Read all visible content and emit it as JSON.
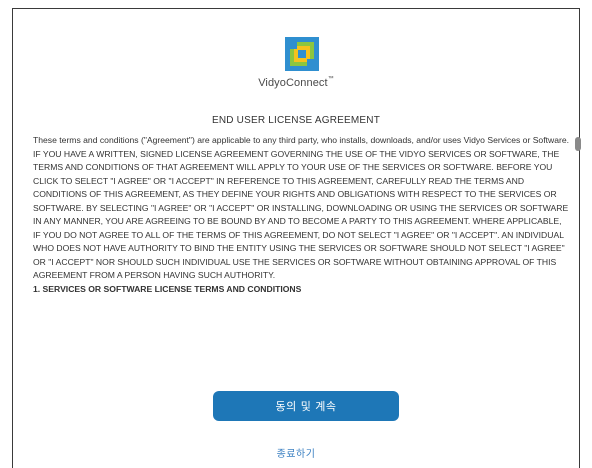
{
  "header": {
    "logo_icon": "vidyo-logo-icon",
    "brand_name": "VidyoConnect",
    "brand_tm": "™",
    "colors": {
      "blue": "#2f8fd0",
      "green": "#8cc63f",
      "yellow": "#f6c21c"
    }
  },
  "eula": {
    "title": "END USER LICENSE AGREEMENT",
    "paragraphs": [
      "These terms and conditions (\"Agreement\") are applicable to any third party, who installs, downloads, and/or uses Vidyo Services or Software.",
      "IF YOU HAVE A WRITTEN, SIGNED LICENSE AGREEMENT GOVERNING THE USE OF THE VIDYO SERVICES OR SOFTWARE, THE TERMS AND CONDITIONS OF THAT AGREEMENT WILL APPLY TO YOUR USE OF THE SERVICES OR SOFTWARE. BEFORE YOU CLICK TO SELECT \"I AGREE\" OR \"I ACCEPT\" IN REFERENCE TO THIS AGREEMENT, CAREFULLY READ THE TERMS AND CONDITIONS OF THIS AGREEMENT, AS THEY DEFINE YOUR RIGHTS AND OBLIGATIONS WITH RESPECT TO THE SERVICES OR SOFTWARE. BY SELECTING \"I AGREE\" OR \"I ACCEPT\" OR INSTALLING, DOWNLOADING OR USING THE SERVICES OR SOFTWARE IN ANY MANNER, YOU ARE AGREEING TO BE BOUND BY AND TO BECOME A PARTY TO THIS AGREEMENT. WHERE APPLICABLE, IF YOU DO NOT AGREE TO ALL OF THE TERMS OF THIS AGREEMENT, DO NOT SELECT \"I AGREE\" OR \"I ACCEPT\". AN INDIVIDUAL WHO DOES NOT HAVE AUTHORITY TO BIND THE ENTITY USING THE SERVICES OR SOFTWARE SHOULD NOT SELECT \"I AGREE\" OR \"I ACCEPT\" NOR SHOULD SUCH INDIVIDUAL USE THE SERVICES OR SOFTWARE WITHOUT OBTAINING APPROVAL OF THIS AGREEMENT FROM A PERSON HAVING SUCH AUTHORITY.",
      "1. SERVICES OR SOFTWARE LICENSE TERMS AND CONDITIONS"
    ]
  },
  "actions": {
    "agree_label": "동의 및 계속",
    "exit_label": "종료하기",
    "button_color": "#1e77b7",
    "link_color": "#3a7fc1"
  }
}
